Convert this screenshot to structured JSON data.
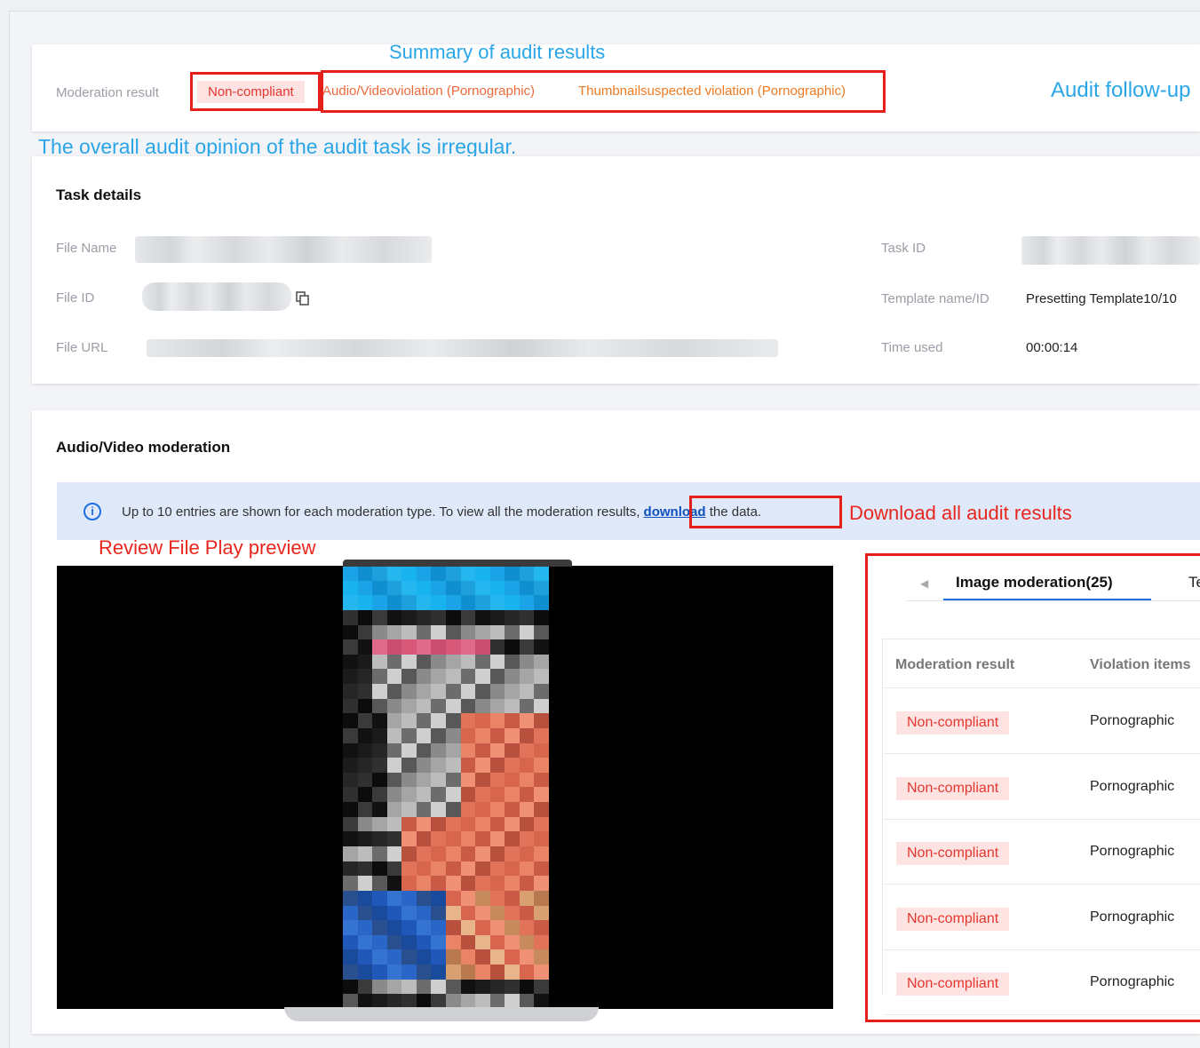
{
  "summary": {
    "moderation_label": "Moderation result",
    "status_tag": "Non-compliant",
    "violations": [
      "Audio/Videoviolation (Pornographic)",
      "Thumbnailsuspected violation (Pornographic)"
    ]
  },
  "annotations": {
    "summary_title": "Summary of audit results",
    "follow_up": "Audit follow-up",
    "overall_opinion": "The overall audit opinion of the audit task is irregular.",
    "download_all": "Download all audit results",
    "preview": "Review File Play preview"
  },
  "task_details": {
    "title": "Task details",
    "file_name_label": "File Name",
    "file_id_label": "File ID",
    "file_url_label": "File URL",
    "task_id_label": "Task ID",
    "template_label": "Template name/ID",
    "template_value": "Presetting Template10/10",
    "time_used_label": "Time used",
    "time_used_value": "00:00:14"
  },
  "av_moderation": {
    "title": "Audio/Video moderation",
    "info_prefix": "Up to 10 entries are shown for each moderation type. To view all the moderation results,",
    "info_link": "download",
    "info_suffix": " the data."
  },
  "image_moderation": {
    "tab_label": "Image moderation(25)",
    "next_tab_partial": "Te",
    "col_result": "Moderation result",
    "col_violation": "Violation items",
    "rows": [
      {
        "result": "Non-compliant",
        "violation": "Pornographic"
      },
      {
        "result": "Non-compliant",
        "violation": "Pornographic"
      },
      {
        "result": "Non-compliant",
        "violation": "Pornographic"
      },
      {
        "result": "Non-compliant",
        "violation": "Pornographic"
      },
      {
        "result": "Non-compliant",
        "violation": "Pornographic"
      }
    ]
  },
  "colors": {
    "annotation_blue": "#2aa6e8",
    "annotation_red": "#e8261e",
    "noncompliant_bg": "#fde3e2",
    "noncompliant_text": "#e5372f",
    "violation_orange": "#ee7a21",
    "link_blue": "#0f4fbf"
  }
}
